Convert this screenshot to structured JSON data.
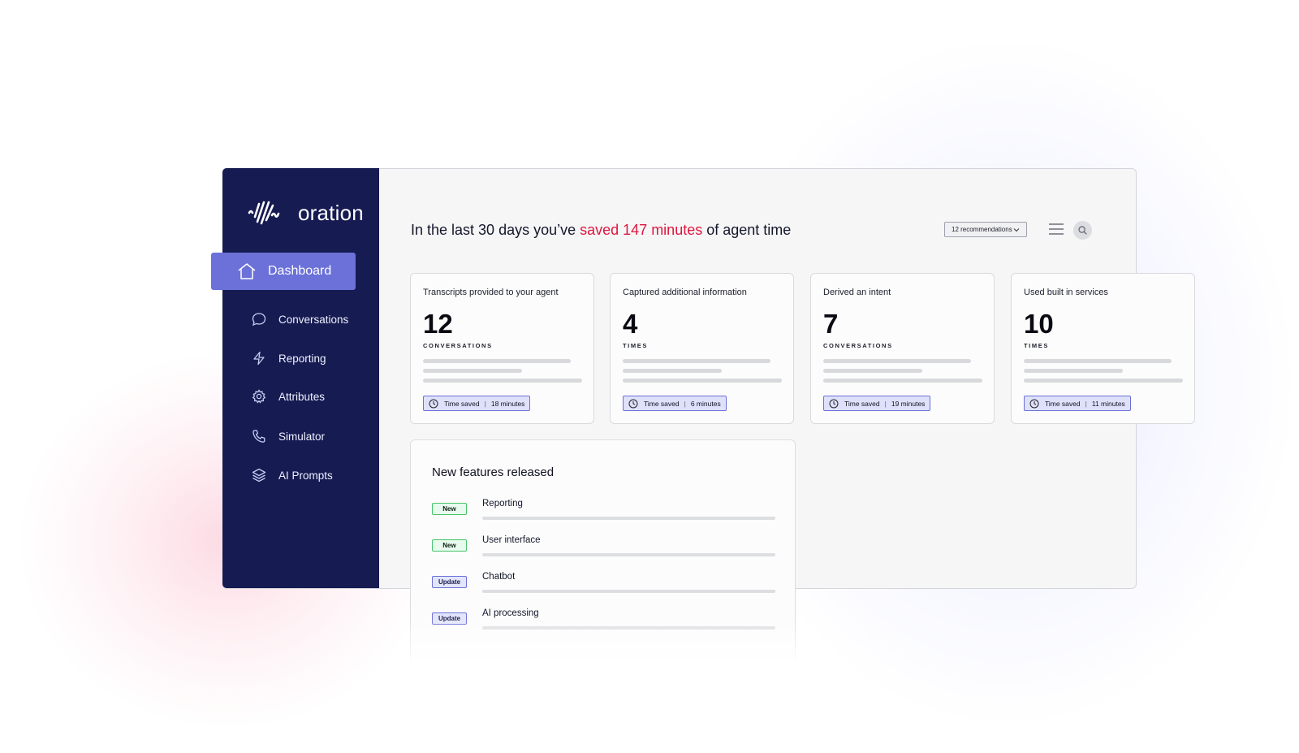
{
  "app": {
    "brand": "oration"
  },
  "sidebar": {
    "active": {
      "label": "Dashboard",
      "icon": "home-icon"
    },
    "items": [
      {
        "label": "Conversations",
        "icon": "chat-bubble-icon"
      },
      {
        "label": "Reporting",
        "icon": "lightning-icon"
      },
      {
        "label": "Attributes",
        "icon": "gear-icon"
      },
      {
        "label": "Simulator",
        "icon": "phone-icon"
      },
      {
        "label": "AI Prompts",
        "icon": "layers-icon"
      }
    ]
  },
  "header": {
    "headline_pre": "In the last 30 days you’ve ",
    "headline_highlight": "saved 147 minutes",
    "headline_post": " of agent time",
    "dropdown_label": "12 recommendations"
  },
  "cards": [
    {
      "title": "Transcripts provided to your agent",
      "value": "12",
      "unit": "CONVERSATIONS",
      "pill_label": "Time saved",
      "pill_value": "18 minutes"
    },
    {
      "title": "Captured additional information",
      "value": "4",
      "unit": "TIMES",
      "pill_label": "Time saved",
      "pill_value": "6 minutes"
    },
    {
      "title": "Derived an intent",
      "value": "7",
      "unit": "CONVERSATIONS",
      "pill_label": "Time saved",
      "pill_value": "19 minutes"
    },
    {
      "title": "Used built in services",
      "value": "10",
      "unit": "TIMES",
      "pill_label": "Time saved",
      "pill_value": "11 minutes"
    }
  ],
  "features": {
    "title": "New features released",
    "items": [
      {
        "badge": "New",
        "label": "Reporting"
      },
      {
        "badge": "New",
        "label": "User interface"
      },
      {
        "badge": "Update",
        "label": "Chatbot"
      },
      {
        "badge": "Update",
        "label": "AI processing"
      }
    ]
  },
  "colors": {
    "sidebar_bg": "#161b52",
    "accent": "#6b71d8",
    "highlight": "#e0163e",
    "new_green": "#46c46a"
  }
}
